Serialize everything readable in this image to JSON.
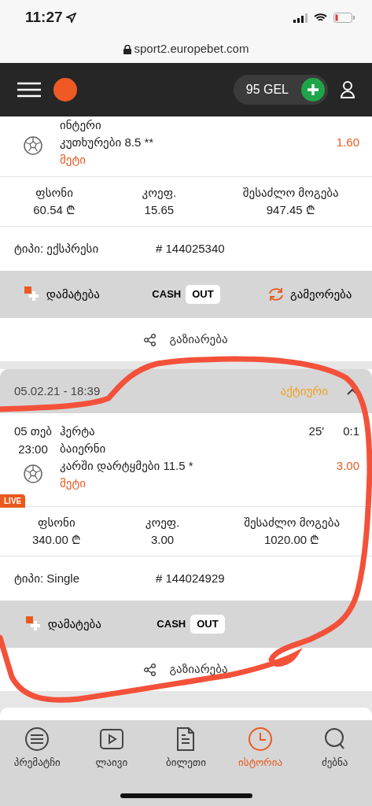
{
  "status_bar": {
    "time": "11:27"
  },
  "address_bar": {
    "url": "sport2.europebet.com"
  },
  "header": {
    "balance": "95 GEL"
  },
  "bets": [
    {
      "events": [
        {
          "teams": [
            "ინტერი"
          ],
          "market": "კუთხურები 8.5 **",
          "selection": "მეტი",
          "odds": "1.60",
          "live": false
        }
      ],
      "stats": [
        {
          "label": "ფსონი",
          "value": "60.54 ₾"
        },
        {
          "label": "კოეფ.",
          "value": "15.65"
        },
        {
          "label": "შესაძლო მოგება",
          "value": "947.45 ₾"
        }
      ],
      "type_label": "ტიპი:",
      "type_value": "ექსპრესი",
      "ticket": "# 144025340",
      "actions": [
        {
          "kind": "add",
          "label": "დამატება"
        },
        {
          "kind": "cashout",
          "label": "CASH",
          "tag": "OUT"
        },
        {
          "kind": "repeat",
          "label": "გამეორება"
        }
      ],
      "share": "გაზიარება"
    },
    {
      "header": {
        "date": "05.02.21 - 18:39",
        "status": "აქტიური",
        "expanded": true
      },
      "events": [
        {
          "date": "05 თებ",
          "time": "23:00",
          "teams": [
            "ჰერტა",
            "ბაიერნი"
          ],
          "market": "კარში დარტყმები 11.5  *",
          "selection": "მეტი",
          "odds": "3.00",
          "minute": "25'",
          "score": "0:1",
          "live": true,
          "live_label": "LIVE"
        }
      ],
      "stats": [
        {
          "label": "ფსონი",
          "value": "340.00 ₾"
        },
        {
          "label": "კოეფ.",
          "value": "3.00"
        },
        {
          "label": "შესაძლო მოგება",
          "value": "1020.00 ₾"
        }
      ],
      "type_label": "ტიპი:",
      "type_value": "Single",
      "ticket": "# 144024929",
      "actions": [
        {
          "kind": "add",
          "label": "დამატება"
        },
        {
          "kind": "cashout",
          "label": "CASH",
          "tag": "OUT"
        },
        {
          "kind": "empty"
        }
      ],
      "share": "გაზიარება"
    }
  ],
  "tab_bar": [
    {
      "label": "პრემატჩი",
      "kind": "list",
      "selected": false
    },
    {
      "label": "ლაივი",
      "kind": "play",
      "selected": false
    },
    {
      "label": "ბილეთი",
      "kind": "doc",
      "selected": false
    },
    {
      "label": "ისტორია",
      "kind": "clock",
      "selected": true
    },
    {
      "label": "ძებნა",
      "kind": "search",
      "selected": false
    }
  ],
  "scribble": {
    "kind": "freehand",
    "color": "#f4513a"
  }
}
